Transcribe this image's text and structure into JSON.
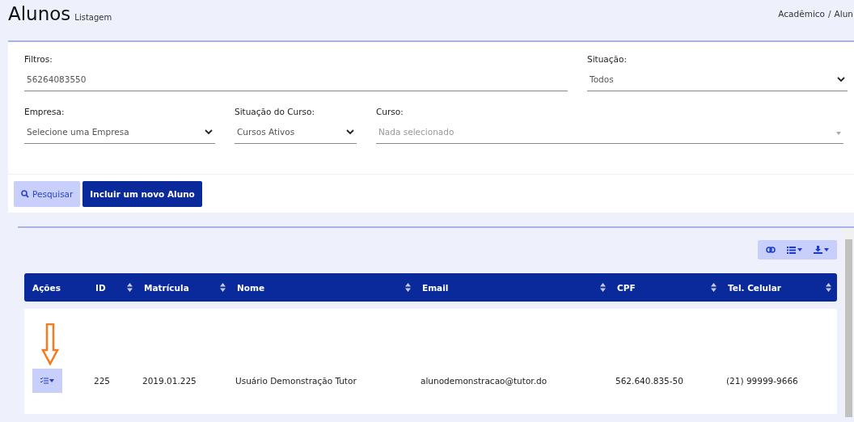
{
  "header": {
    "title": "Alunos",
    "subtitle": "Listagem",
    "breadcrumb": [
      "Acadêmico",
      "/",
      "Alun"
    ]
  },
  "filters": {
    "fields": [
      {
        "kind": "text",
        "label": "Filtros:",
        "value": "56264083550"
      },
      {
        "kind": "select",
        "label": "Situação:",
        "value": "Todos"
      },
      {
        "kind": "select",
        "label": "Empresa:",
        "value": "Selecione uma Empresa"
      },
      {
        "kind": "select",
        "label": "Situação do Curso:",
        "value": "Cursos Ativos"
      },
      {
        "kind": "multiselect",
        "label": "Curso:",
        "placeholder": "Nada selecionado"
      }
    ],
    "buttons": [
      {
        "kind": "search",
        "label": "Pesquisar"
      },
      {
        "kind": "primary",
        "label": "Incluir um novo Aluno"
      }
    ]
  },
  "table": {
    "columns": [
      {
        "label": "Ações",
        "sortable": false
      },
      {
        "label": "ID",
        "sortable": true
      },
      {
        "label": "Matrícula",
        "sortable": true
      },
      {
        "label": "Nome",
        "sortable": true
      },
      {
        "label": "Email",
        "sortable": true
      },
      {
        "label": "CPF",
        "sortable": true
      },
      {
        "label": "Tel. Celular",
        "sortable": true
      }
    ],
    "rows": [
      {
        "cells": [
          "",
          "225",
          "2019.01.225",
          "Usuário Demonstração Tutor",
          "alunodemonstracao@tutor.do",
          "562.640.835-50",
          "(21) 99999-9666"
        ]
      }
    ]
  }
}
